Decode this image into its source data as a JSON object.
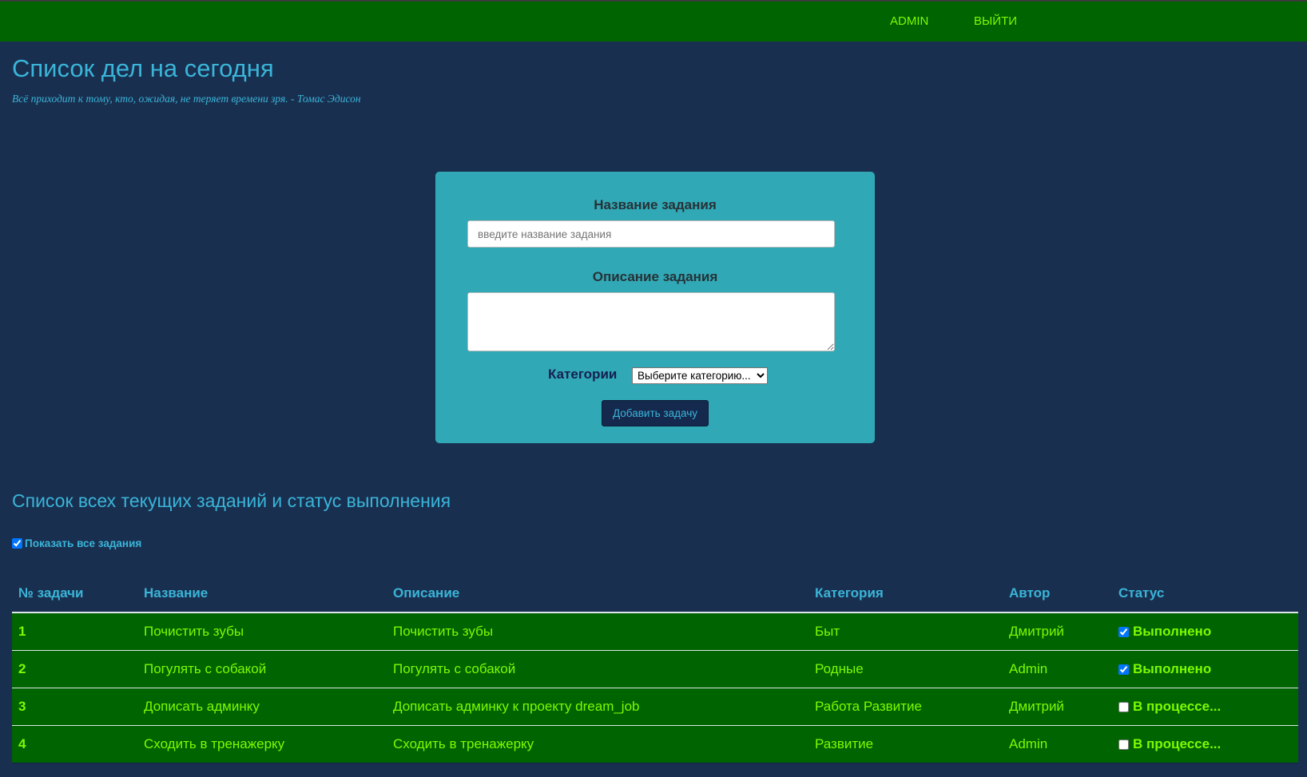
{
  "nav": {
    "admin": "ADMIN",
    "logout": "ВЫЙТИ"
  },
  "header": {
    "title": "Список дел на сегодня",
    "quote": "Всё приходит к тому, кто, ожидая, не теряет времени зря. - Томас Эдисон"
  },
  "form": {
    "name_label": "Название задания",
    "name_placeholder": "введите название задания",
    "name_value": "",
    "description_label": "Описание задания",
    "description_value": "",
    "category_label": "Категории",
    "category_selected": "Выберите категорию...",
    "submit_label": "Добавить задачу"
  },
  "tasks_section": {
    "title": "Список всех текущих заданий и статус выполнения",
    "show_all_label": "Показать все задания",
    "show_all_checked": true
  },
  "table": {
    "headers": [
      "№ задачи",
      "Название",
      "Описание",
      "Категория",
      "Автор",
      "Статус"
    ],
    "rows": [
      {
        "num": "1",
        "name": "Почистить зубы",
        "description": "Почистить зубы",
        "category": "Быт",
        "author": "Дмитрий",
        "status": "Выполнено",
        "done": true
      },
      {
        "num": "2",
        "name": "Погулять с собакой",
        "description": "Погулять с собакой",
        "category": "Родные",
        "author": "Admin",
        "status": "Выполнено",
        "done": true
      },
      {
        "num": "3",
        "name": "Дописать админку",
        "description": "Дописать админку к проекту dream_job",
        "category": "Работа Развитие",
        "author": "Дмитрий",
        "status": "В процессе...",
        "done": false
      },
      {
        "num": "4",
        "name": "Сходить в тренажерку",
        "description": "Сходить в тренажерку",
        "category": "Развитие",
        "author": "Admin",
        "status": "В процессе...",
        "done": false
      }
    ]
  },
  "colors": {
    "page_bg": "#192f50",
    "nav_bg": "#006400",
    "accent_text": "#3ab5d8",
    "row_text": "#7cfc00",
    "form_bg": "#31a8b5",
    "button_bg": "#15284d"
  }
}
